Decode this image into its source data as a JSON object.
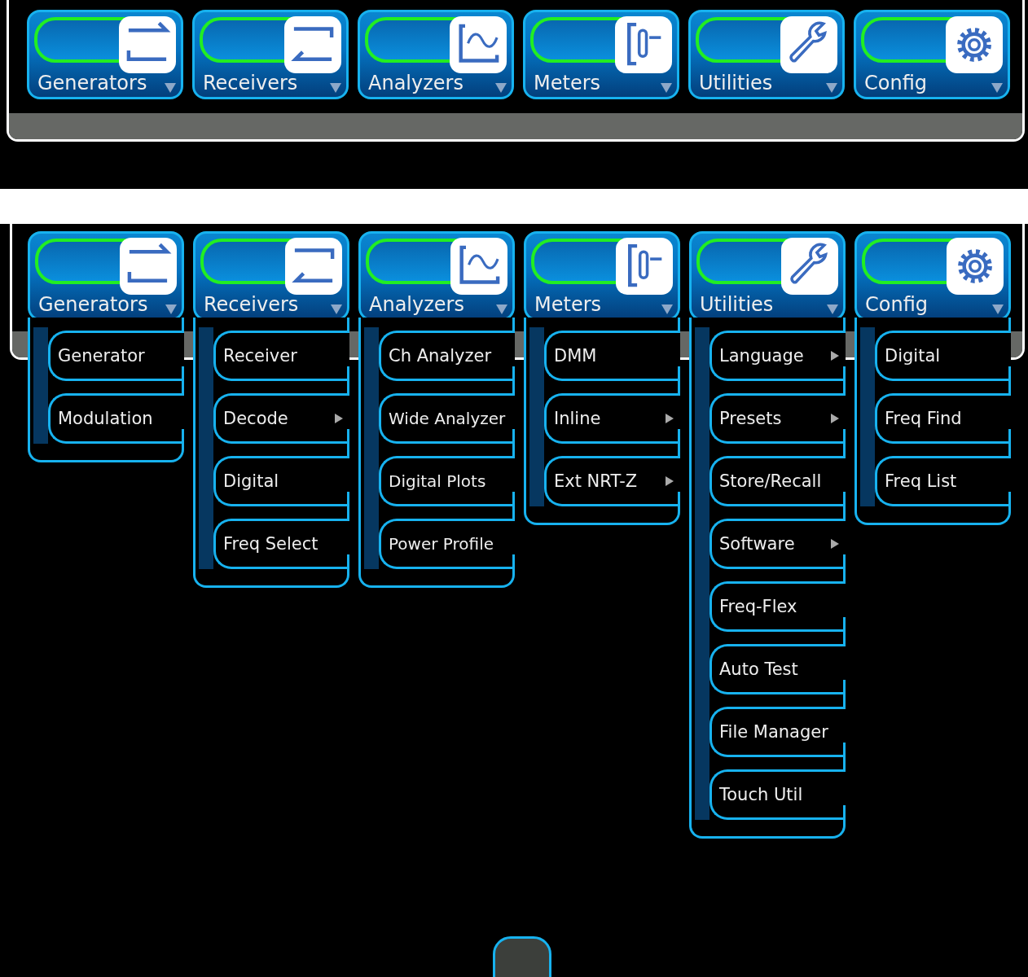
{
  "screens": [
    {
      "tabs": [
        {
          "label": "Generators",
          "kind": "generators"
        },
        {
          "label": "Receivers",
          "kind": "receivers"
        },
        {
          "label": "Analyzers",
          "kind": "analyzers"
        },
        {
          "label": "Meters",
          "kind": "meters"
        },
        {
          "label": "Utilities",
          "kind": "utilities"
        },
        {
          "label": "Config",
          "kind": "config"
        }
      ]
    },
    {
      "tabs": [
        {
          "label": "Generators",
          "kind": "generators",
          "items": [
            {
              "label": "Generator",
              "submenu": false
            },
            {
              "label": "Modulation",
              "submenu": false
            }
          ]
        },
        {
          "label": "Receivers",
          "kind": "receivers",
          "items": [
            {
              "label": "Receiver",
              "submenu": false
            },
            {
              "label": "Decode",
              "submenu": true
            },
            {
              "label": "Digital",
              "submenu": false
            },
            {
              "label": "Freq Select",
              "submenu": false
            }
          ]
        },
        {
          "label": "Analyzers",
          "kind": "analyzers",
          "items": [
            {
              "label": "Ch Analyzer",
              "submenu": false
            },
            {
              "label": "Wide Analyzer",
              "submenu": false
            },
            {
              "label": "Digital Plots",
              "submenu": false
            },
            {
              "label": "Power Profile",
              "submenu": false
            }
          ]
        },
        {
          "label": "Meters",
          "kind": "meters",
          "items": [
            {
              "label": "DMM",
              "submenu": false
            },
            {
              "label": "Inline",
              "submenu": true
            },
            {
              "label": "Ext NRT-Z",
              "submenu": true
            }
          ]
        },
        {
          "label": "Utilities",
          "kind": "utilities",
          "items": [
            {
              "label": "Language",
              "submenu": true
            },
            {
              "label": "Presets",
              "submenu": true
            },
            {
              "label": "Store/Recall",
              "submenu": false
            },
            {
              "label": "Software",
              "submenu": true
            },
            {
              "label": "Freq-Flex",
              "submenu": false
            },
            {
              "label": "Auto Test",
              "submenu": false
            },
            {
              "label": "File Manager",
              "submenu": false
            },
            {
              "label": "Touch Util",
              "submenu": false
            }
          ]
        },
        {
          "label": "Config",
          "kind": "config",
          "items": [
            {
              "label": "Digital",
              "submenu": false
            },
            {
              "label": "Freq Find",
              "submenu": false
            },
            {
              "label": "Freq List",
              "submenu": false
            }
          ]
        }
      ]
    }
  ]
}
